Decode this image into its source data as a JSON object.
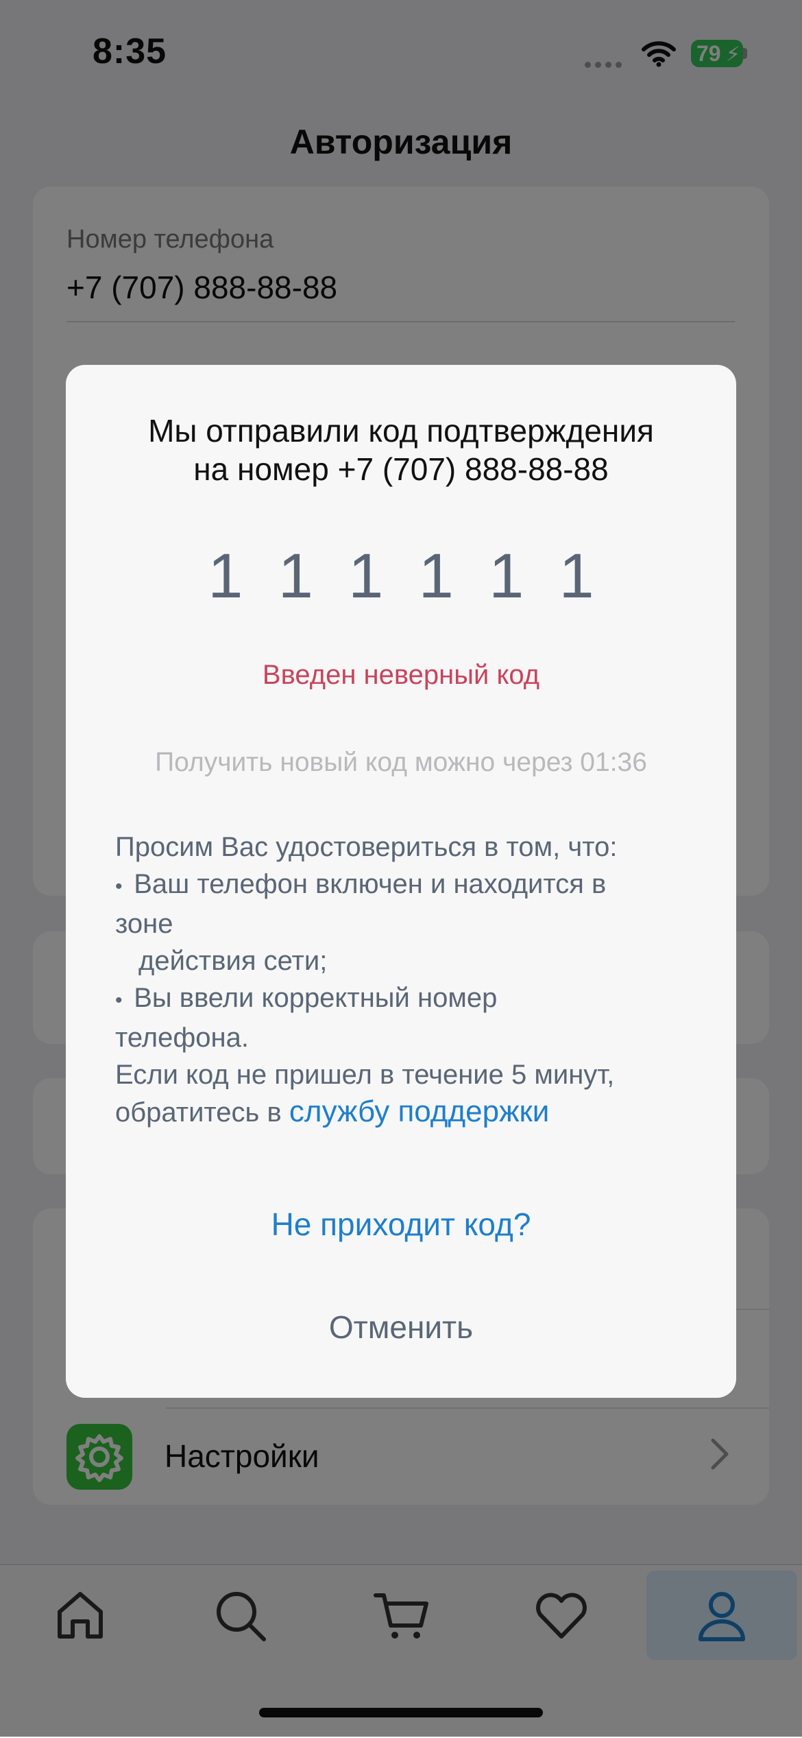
{
  "status_bar": {
    "time": "8:35",
    "battery": "79"
  },
  "header": {
    "title": "Авторизация"
  },
  "phone_card": {
    "label": "Номер телефона",
    "value": "+7 (707) 888-88-88"
  },
  "settings_item": {
    "label": "Настройки"
  },
  "dialog": {
    "title_line1": "Мы отправили код подтверждения",
    "title_line2": "на номер +7 (707) 888-88-88",
    "code_digits": [
      "1",
      "1",
      "1",
      "1",
      "1",
      "1"
    ],
    "error": "Введен неверный код",
    "timer": "Получить новый код можно через 01:36",
    "info_intro": "Просим Вас удостовериться в том, что:",
    "bullet1_a": "Ваш телефон включен и находится в",
    "bullet1_b": "зоне",
    "bullet1_c": "действия сети;",
    "bullet2_a": "Вы ввели корректный номер",
    "bullet2_b": "телефона.",
    "info_outro_1": "Если код не пришел в течение 5 минут,",
    "info_outro_2": "обратитесь в",
    "support_link": "службу поддержки",
    "no_code_button": "Не приходит код?",
    "cancel_button": "Отменить"
  },
  "tabbar": {
    "items": [
      {
        "icon": "home-icon"
      },
      {
        "icon": "search-icon"
      },
      {
        "icon": "cart-icon"
      },
      {
        "icon": "heart-icon"
      },
      {
        "icon": "profile-icon",
        "active": true
      }
    ]
  },
  "colors": {
    "accent": "#1f7ecb",
    "error": "#c8445c",
    "settings_green": "#35c53a",
    "battery_green": "#34c759"
  }
}
